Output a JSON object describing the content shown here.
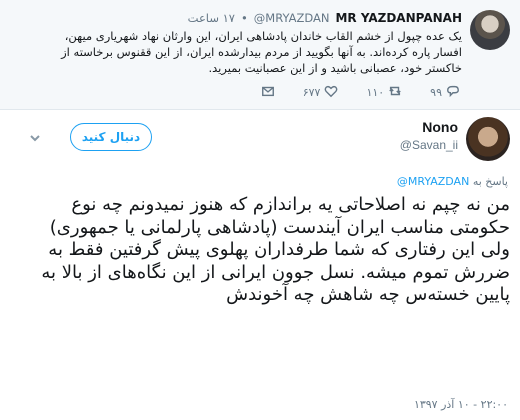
{
  "quoted_tweet": {
    "display_name": "MR YAZDANPANAH",
    "handle": "@MRYAZDAN",
    "time": "۱۷ ساعت",
    "separator": "•",
    "text": "یک عده چپول از خشم القاب خاندان پادشاهی ایران، این وارثان نهاد شهریاری میهن، افسار پاره کرده‌اند. به آنها بگویید از مردم بیدارشده ایران، از این ققنوس برخاسته از خاکستر خود، عصبانی باشید و از این عصبانیت بمیرید.",
    "reply_count": "۹۹",
    "retweet_count": "۱۱۰",
    "like_count": "۶۷۷"
  },
  "reply_tweet": {
    "display_name": "Nono",
    "handle": "@Savan_ii",
    "follow_label": "دنبال کنید",
    "reply_to_prefix": "پاسخ به",
    "reply_to_handle": "@MRYAZDAN",
    "text": "من نه چپم نه اصلاحاتی یه براندازم که هنوز نمیدونم چه نوع حکومتی مناسب ایران آیندست (پادشاهی پارلمانی یا جمهوری) ولی این رفتاری که شما طرفداران پهلوی پیش گرفتین فقط به ضررش تموم میشه. نسل جوون ایرانی از این نگاه‌های از بالا به پایین خسته‌س چه شاهش چه آخوندش",
    "timestamp": "۲۲:۰۰ - ۱۰ آذر ۱۳۹۷"
  },
  "icons": {
    "reply": "reply-icon",
    "retweet": "retweet-icon",
    "like": "heart-icon",
    "dm": "mail-icon",
    "menu": "chevron-down-icon"
  },
  "colors": {
    "accent": "#1da1f2",
    "muted": "#657786",
    "quoted_bg": "#f5f8fa"
  }
}
